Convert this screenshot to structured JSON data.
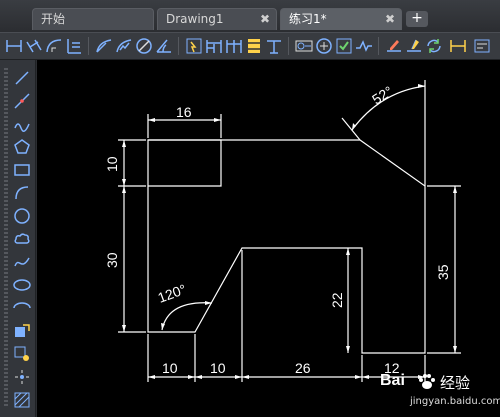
{
  "tabs": [
    {
      "label": "开始",
      "closable": false,
      "active": false
    },
    {
      "label": "Drawing1",
      "closable": true,
      "active": false
    },
    {
      "label": "练习1*",
      "closable": true,
      "active": true
    }
  ],
  "tab_add_label": "+",
  "tab_close_glyph": "✖",
  "toolbar_icons": [
    "dim-linear-icon",
    "dim-aligned-icon",
    "dim-arc-length-icon",
    "dim-ordinate-icon",
    "dim-radius-icon",
    "dim-jogged-icon",
    "dim-diameter-icon",
    "dim-angular-icon",
    "quick-dim-icon",
    "dim-baseline-icon",
    "dim-continue-icon",
    "dim-space-icon",
    "dim-break-icon",
    "tolerance-icon",
    "center-mark-icon",
    "inspect-icon",
    "jogged-linear-icon",
    "dim-edit-icon",
    "dim-text-edit-icon",
    "dim-update-icon"
  ],
  "left_tools": [
    "line-icon",
    "construction-line-icon",
    "polyline-icon",
    "polygon-icon",
    "rectangle-icon",
    "arc-icon",
    "circle-icon",
    "revision-cloud-icon",
    "spline-icon",
    "ellipse-icon",
    "ellipse-arc-icon",
    "insert-block-icon",
    "make-block-icon",
    "point-icon",
    "hatch-icon"
  ],
  "drawing": {
    "dimensions": {
      "top_width": "16",
      "left_top_height": "10",
      "left_height": "30",
      "chamfer_angle": "52°",
      "fillet_angle": "120°",
      "right_height": "35",
      "inner_height": "22",
      "bottom_1": "10",
      "bottom_2": "10",
      "bottom_3": "26",
      "bottom_4": "12"
    },
    "colors": {
      "background": "#000000",
      "lines": "#ffffff"
    }
  },
  "watermark": {
    "brand": "Bai",
    "brand_cn": "经验",
    "url": "jingyan.baidu.com"
  }
}
